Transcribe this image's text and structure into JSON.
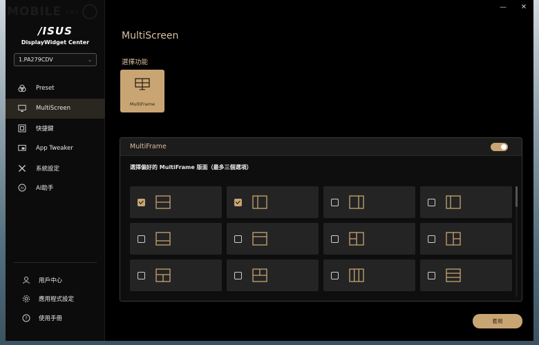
{
  "watermark": {
    "text": "MOBILE",
    "small": "手機王"
  },
  "brand": {
    "logo": "/ISUS",
    "app_name": "DisplayWidget Center"
  },
  "monitor_select": {
    "value": "1.PA279CDV"
  },
  "sidebar": {
    "items": [
      {
        "label": "Preset",
        "icon": "preset-icon"
      },
      {
        "label": "MultiScreen",
        "icon": "monitor-icon",
        "active": true
      },
      {
        "label": "快捷鍵",
        "icon": "shortcut-icon"
      },
      {
        "label": "App Tweaker",
        "icon": "app-tweaker-icon"
      },
      {
        "label": "系統設定",
        "icon": "tools-icon"
      },
      {
        "label": "AI助手",
        "icon": "ai-icon"
      }
    ],
    "bottom": [
      {
        "label": "用戶中心",
        "icon": "user-icon"
      },
      {
        "label": "應用程式設定",
        "icon": "gear-icon"
      },
      {
        "label": "使用手冊",
        "icon": "help-icon"
      }
    ]
  },
  "window_controls": {
    "minimize": "—",
    "close": "✕"
  },
  "main": {
    "title": "MultiScreen",
    "section_label": "選擇功能",
    "feature": {
      "label": "MultiFrame",
      "icon": "multiframe-icon"
    }
  },
  "panel": {
    "title": "MultiFrame",
    "toggle_on": true,
    "description": "選擇偏好的 MultiFrame 版面（最多三個選項）",
    "layouts": [
      {
        "checked": true,
        "type": "split-horizontal"
      },
      {
        "checked": true,
        "type": "split-vertical"
      },
      {
        "checked": false,
        "type": "split-vertical-right"
      },
      {
        "checked": false,
        "type": "split-vertical-left"
      },
      {
        "checked": false,
        "type": "top-large-bottom"
      },
      {
        "checked": false,
        "type": "top-middle-band"
      },
      {
        "checked": false,
        "type": "left-half-right-split"
      },
      {
        "checked": false,
        "type": "left-full-right-split"
      },
      {
        "checked": false,
        "type": "top-band-bottom-split"
      },
      {
        "checked": false,
        "type": "top-split-bottom-band"
      },
      {
        "checked": false,
        "type": "three-columns"
      },
      {
        "checked": false,
        "type": "three-rows"
      }
    ]
  },
  "apply_label": "套用",
  "colors": {
    "accent": "#c9a574",
    "title": "#d9c0a0",
    "tile": "#242424",
    "active_nav": "#2a2620"
  }
}
